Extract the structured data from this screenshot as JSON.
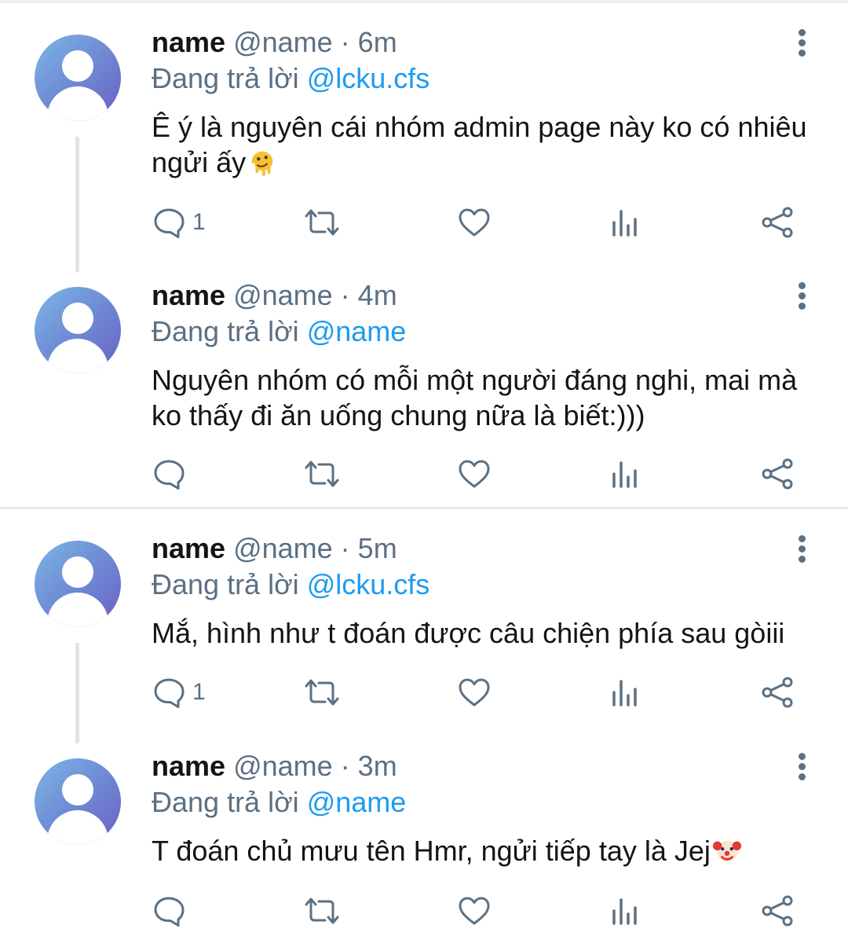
{
  "tweets": [
    {
      "name": "name",
      "handle": "@name",
      "sep": " · ",
      "time": "6m",
      "reply_prefix": "Đang trả lời ",
      "reply_to": "@lcku.cfs",
      "text": "Ê ý là nguyên cái nhóm admin page này ko có nhiêu ngửi ấy",
      "emoji": "melting-face",
      "reply_count": "1"
    },
    {
      "name": "name",
      "handle": "@name",
      "sep": " · ",
      "time": "4m",
      "reply_prefix": "Đang trả lời ",
      "reply_to": "@name",
      "text": "Nguyên nhóm có mỗi một người đáng nghi, mai mà ko thấy đi ăn uống chung nữa là biết:)))",
      "emoji": "",
      "reply_count": ""
    },
    {
      "name": "name",
      "handle": "@name",
      "sep": " · ",
      "time": "5m",
      "reply_prefix": "Đang trả lời ",
      "reply_to": "@lcku.cfs",
      "text": "Mắ, hình như t đoán được câu chiện phía sau gòiii",
      "emoji": "",
      "reply_count": "1"
    },
    {
      "name": "name",
      "handle": "@name",
      "sep": " · ",
      "time": "3m",
      "reply_prefix": "Đang trả lời ",
      "reply_to": "@name",
      "text": "T đoán chủ mưu tên Hmr, ngửi tiếp tay là Jej",
      "emoji": "clown-face",
      "reply_count": ""
    }
  ],
  "icons": [
    "reply-icon",
    "retweet-icon",
    "like-icon",
    "analytics-icon",
    "share-icon",
    "more-options-icon"
  ],
  "colors": {
    "muted": "#5b7083",
    "mention": "#1d9bf0",
    "text": "#141414",
    "divider": "#e6ecf0"
  }
}
